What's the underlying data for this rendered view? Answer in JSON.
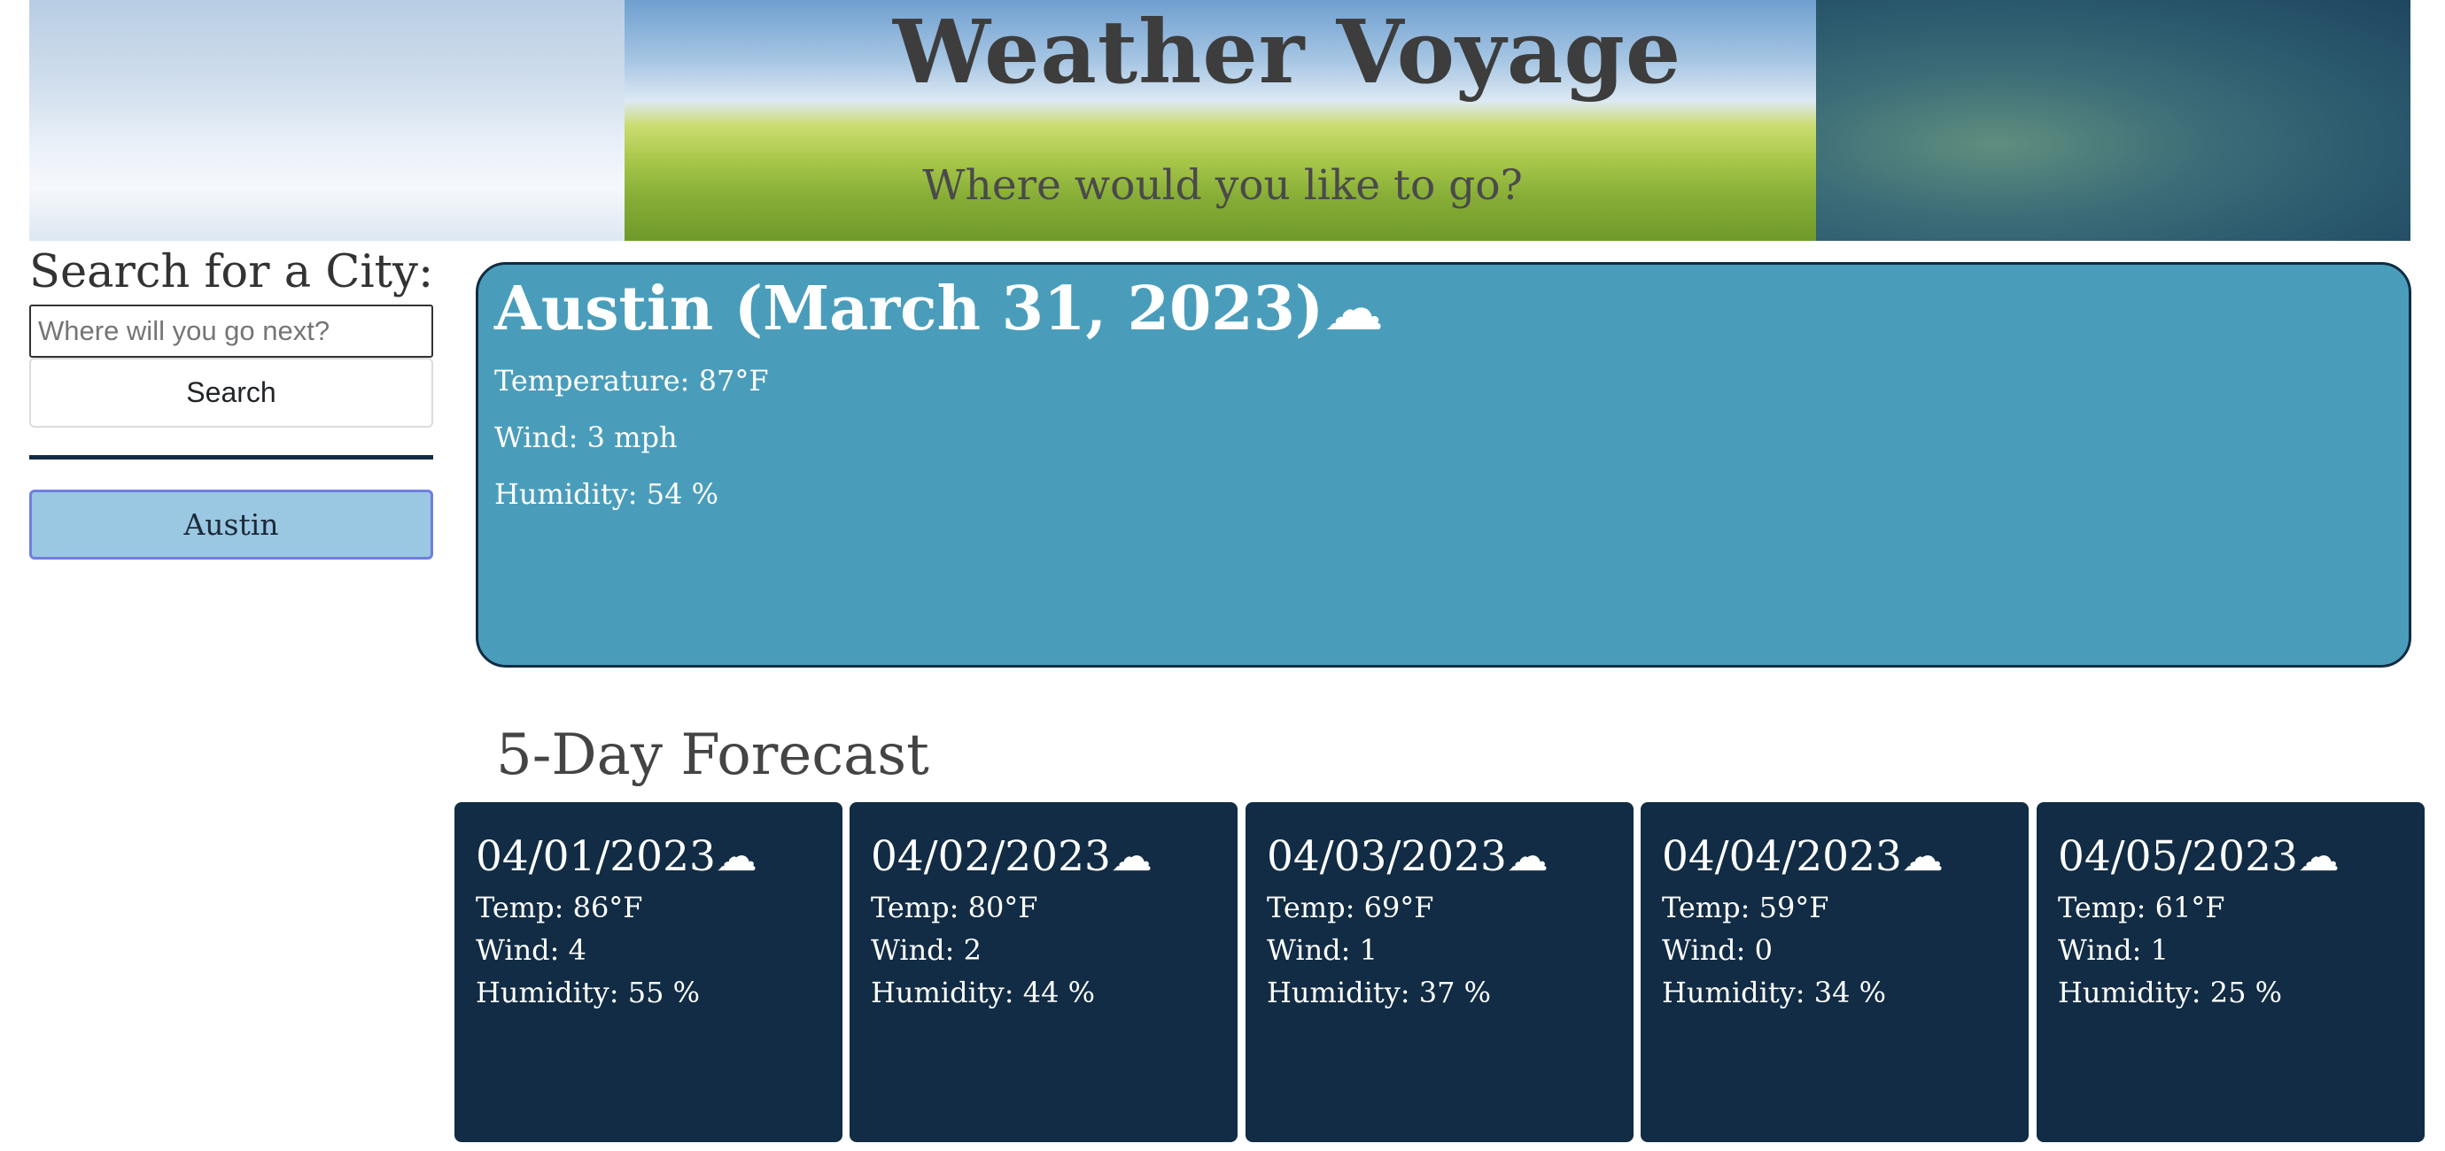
{
  "header": {
    "title": "Weather Voyage",
    "subtitle": "Where would you like to go?"
  },
  "sidebar": {
    "heading": "Search for a City:",
    "search_placeholder": "Where will you go next?",
    "search_value": "",
    "search_button": "Search",
    "history": [
      "Austin"
    ]
  },
  "current": {
    "title": "Austin (March 31, 2023)",
    "icon": "cloud-icon",
    "temperature": "Temperature: 87°F",
    "wind": "Wind: 3 mph",
    "humidity": "Humidity: 54 %"
  },
  "forecast": {
    "heading": "5-Day Forecast",
    "days": [
      {
        "date": "04/01/2023",
        "icon": "cloud-icon",
        "temp": "Temp: 86°F",
        "wind": "Wind: 4",
        "humidity": "Humidity: 55 %"
      },
      {
        "date": "04/02/2023",
        "icon": "cloud-icon",
        "temp": "Temp: 80°F",
        "wind": "Wind: 2",
        "humidity": "Humidity: 44 %"
      },
      {
        "date": "04/03/2023",
        "icon": "cloud-icon",
        "temp": "Temp: 69°F",
        "wind": "Wind: 1",
        "humidity": "Humidity: 37 %"
      },
      {
        "date": "04/04/2023",
        "icon": "cloud-icon",
        "temp": "Temp: 59°F",
        "wind": "Wind: 0",
        "humidity": "Humidity: 34 %"
      },
      {
        "date": "04/05/2023",
        "icon": "cloud-icon",
        "temp": "Temp: 61°F",
        "wind": "Wind: 1",
        "humidity": "Humidity: 25 %"
      }
    ]
  },
  "colors": {
    "current_bg": "#4a9dba",
    "card_bg": "#112c44",
    "history_bg": "#9ac7e1"
  }
}
